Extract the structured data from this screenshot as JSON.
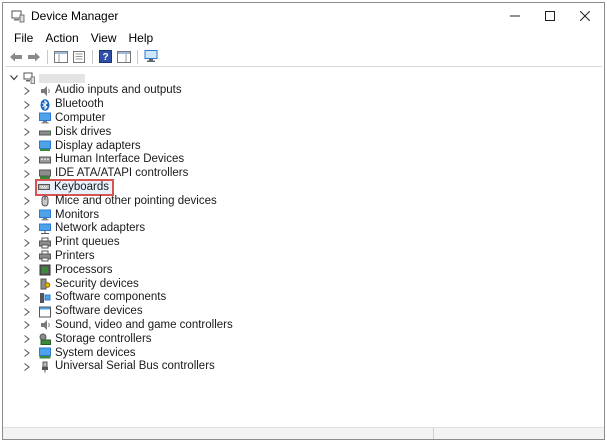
{
  "window": {
    "title": "Device Manager",
    "controls": {
      "minimize": "minimize",
      "maximize": "maximize",
      "close": "close"
    }
  },
  "menu": {
    "items": [
      "File",
      "Action",
      "View",
      "Help"
    ]
  },
  "toolbar": {
    "buttons": [
      "back-icon",
      "forward-icon",
      "show-hide-tree-icon",
      "properties-icon",
      "help-icon",
      "action-pane-icon",
      "scan-hardware-icon"
    ]
  },
  "tree": {
    "root": {
      "label": "",
      "icon": "computer-icon",
      "expanded": true
    },
    "items": [
      {
        "label": "Audio inputs and outputs",
        "icon": "speaker-icon"
      },
      {
        "label": "Bluetooth",
        "icon": "bluetooth-icon"
      },
      {
        "label": "Computer",
        "icon": "monitor-icon"
      },
      {
        "label": "Disk drives",
        "icon": "disk-drive-icon"
      },
      {
        "label": "Display adapters",
        "icon": "display-adapter-icon"
      },
      {
        "label": "Human Interface Devices",
        "icon": "hid-icon"
      },
      {
        "label": "IDE ATA/ATAPI controllers",
        "icon": "ide-controller-icon"
      },
      {
        "label": "Keyboards",
        "icon": "keyboard-icon",
        "selected": true
      },
      {
        "label": "Mice and other pointing devices",
        "icon": "mouse-icon"
      },
      {
        "label": "Monitors",
        "icon": "monitor-icon"
      },
      {
        "label": "Network adapters",
        "icon": "network-adapter-icon"
      },
      {
        "label": "Print queues",
        "icon": "printer-icon"
      },
      {
        "label": "Printers",
        "icon": "printer-icon"
      },
      {
        "label": "Processors",
        "icon": "processor-icon"
      },
      {
        "label": "Security devices",
        "icon": "security-device-icon"
      },
      {
        "label": "Software components",
        "icon": "software-component-icon"
      },
      {
        "label": "Software devices",
        "icon": "software-device-icon"
      },
      {
        "label": "Sound, video and game controllers",
        "icon": "sound-icon"
      },
      {
        "label": "Storage controllers",
        "icon": "storage-controller-icon"
      },
      {
        "label": "System devices",
        "icon": "system-device-icon"
      },
      {
        "label": "Universal Serial Bus controllers",
        "icon": "usb-icon"
      }
    ]
  },
  "colors": {
    "selection_outline": "#d9534f",
    "icon_blue": "#2b79d4"
  }
}
